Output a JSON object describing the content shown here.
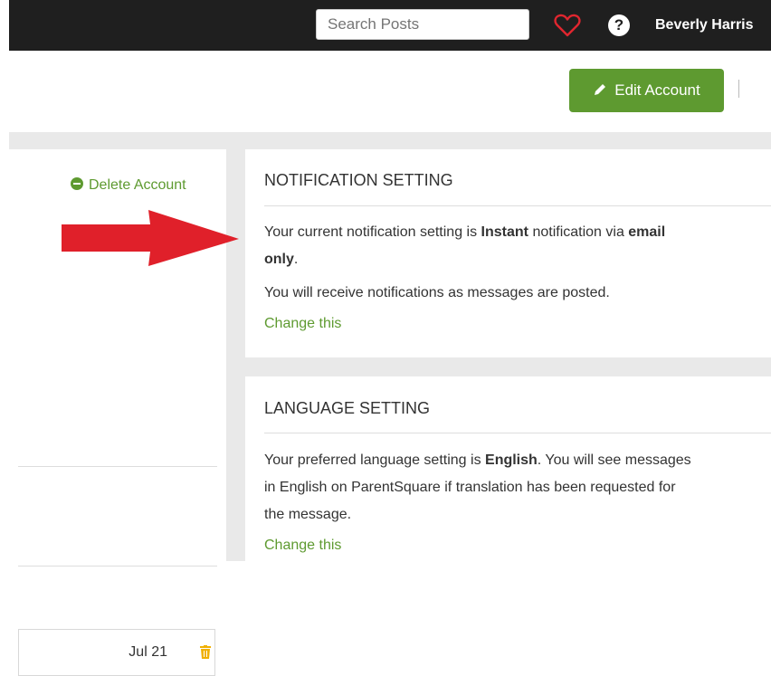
{
  "topbar": {
    "search_placeholder": "Search Posts",
    "user_name": "Beverly Harris",
    "help_glyph": "?"
  },
  "header": {
    "edit_account_label": "Edit Account"
  },
  "left_panel": {
    "delete_account_label": "Delete Account",
    "item_date": "Jul 21"
  },
  "notification_card": {
    "title": "NOTIFICATION SETTING",
    "line1_prefix": "Your current notification setting is ",
    "line1_bold1": "Instant",
    "line1_mid": " notification via ",
    "line1_bold2": "email",
    "line2_bold": "only",
    "line2_suffix": ".",
    "line3": "You will receive notifications as messages are posted.",
    "change_link": "Change this"
  },
  "language_card": {
    "title": "LANGUAGE SETTING",
    "text_prefix": "Your preferred language setting is ",
    "text_bold": "English",
    "text_line1_suffix": ". You will see messages",
    "text_line2": "in English on ParentSquare if translation has been requested for",
    "text_line3": "the message.",
    "change_link": "Change this"
  },
  "colors": {
    "topbar": "#1f1f1f",
    "accent_green": "#5e9a30",
    "arrow_red": "#e0202a",
    "background_gray": "#e9e9e9"
  },
  "icons": [
    "heart-icon",
    "help-icon",
    "pencil-icon",
    "minus-circle-icon",
    "trash-icon",
    "red-arrow"
  ]
}
